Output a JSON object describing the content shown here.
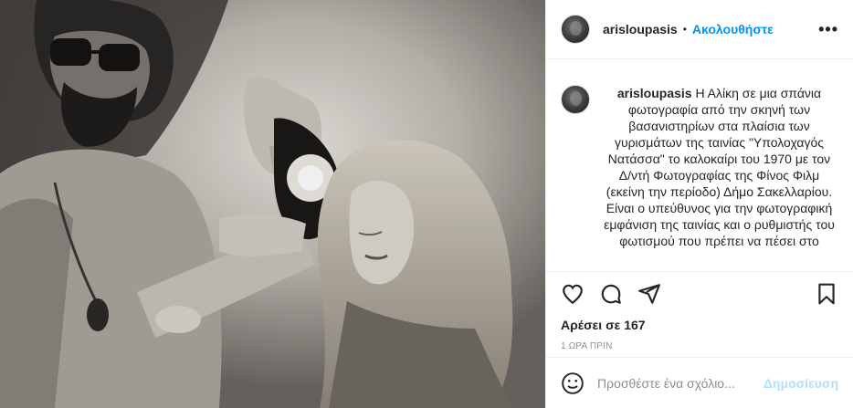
{
  "post": {
    "username": "arisloupasis",
    "separator": "•",
    "follow_label": "Ακολουθήστε",
    "more_label": "•••",
    "caption": {
      "username": "arisloupasis",
      "text": "Η Αλίκη σε μια σπάνια φωτογραφία από την σκηνή των βασανιστηρίων στα πλαίσια των γυρισμάτων της ταινίας \"Υπολοχαγός Νατάσσα\" το καλοκαίρι του 1970 με τον Δ/ντή Φωτογραφίας της Φίνος Φιλμ (εκείνη την περίοδο) Δήμο Σακελλαρίου. Είναι ο υπεύθυνος για την φωτογραφική εμφάνιση της ταινίας και ο ρυθμιστής του φωτισμού που πρέπει να πέσει στο"
    },
    "actions": {
      "like_icon": "heart-icon",
      "comment_icon": "comment-icon",
      "share_icon": "share-icon",
      "save_icon": "bookmark-icon"
    },
    "likes_text": "Αρέσει σε 167",
    "timestamp": "1 ΩΡΑ ΠΡΙΝ",
    "add_comment": {
      "emoji_icon": "emoji-icon",
      "placeholder": "Προσθέστε ένα σχόλιο...",
      "post_label": "Δημοσίευση"
    }
  }
}
